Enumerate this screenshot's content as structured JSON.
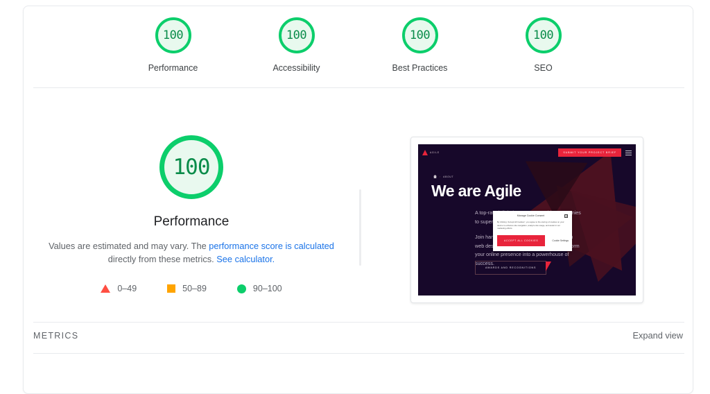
{
  "report": {
    "category_gauges": [
      {
        "score": "100",
        "label": "Performance",
        "state": "pass"
      },
      {
        "score": "100",
        "label": "Accessibility",
        "state": "pass"
      },
      {
        "score": "100",
        "label": "Best Practices",
        "state": "pass"
      },
      {
        "score": "100",
        "label": "SEO",
        "state": "pass"
      }
    ],
    "featured": {
      "score": "100",
      "title": "Performance",
      "description_part1": "Values are estimated and may vary. The ",
      "link1": "performance score is calculated",
      "description_part2": " directly from these metrics. ",
      "link2": "See calculator.",
      "legend": [
        {
          "icon": "triangle-red",
          "range": "0–49",
          "color": "#ff4e42"
        },
        {
          "icon": "square-orange",
          "range": "50–89",
          "color": "#ffa400"
        },
        {
          "icon": "circle-green",
          "range": "90–100",
          "color": "#0cce6b"
        }
      ]
    },
    "footer": {
      "metrics_label": "METRICS",
      "expand_view_label": "Expand view"
    }
  },
  "thumbnail": {
    "brand": "Agile",
    "cta_button": "Submit your project brief",
    "breadcrumb_separator": "›",
    "breadcrumb_current": "About",
    "headline": "We are Agile",
    "paragraph1": "A top-rated digital agency, trusted by companies to supercharge their business growth.",
    "paragraph2": "Join hands with our team whose expertise in web design and digital marketing can transform your online presence into a powerhouse of success.",
    "awards_button": "Awards and Recognitions",
    "cookie_dialog": {
      "title": "Manage Cookie Consent",
      "body": "By clicking “Accept All Cookies”, you agree to the storing of cookies on your device to enhance site navigation, analyze site usage, and assist in our marketing efforts.",
      "accept_label": "Accept All Cookies",
      "settings_label": "Cookie Settings",
      "close_label": "✕"
    }
  }
}
